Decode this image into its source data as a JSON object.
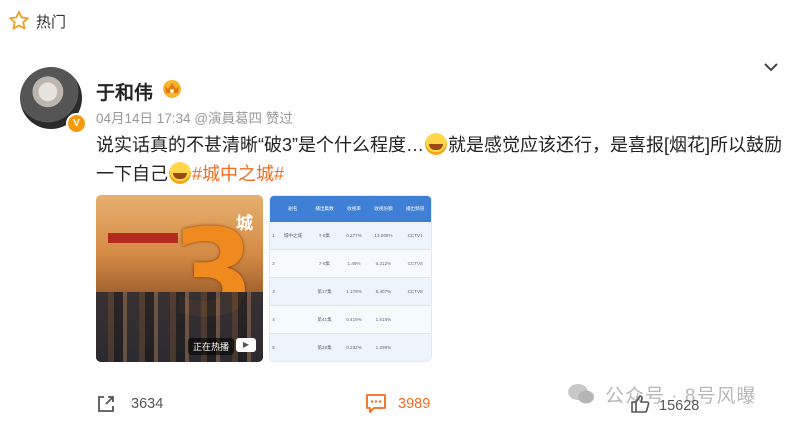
{
  "header": {
    "label": "热门"
  },
  "author": {
    "name": "于和伟",
    "meta": "04月14日 17:34 @演員葛四 赞过"
  },
  "post": {
    "text_part1": "说实话真的不甚清晰“破3”是个什么程度…",
    "text_part2": "就是感觉应该还行，是喜报[烟花]所以鼓励一下自己",
    "hashtag": "#城中之城#"
  },
  "poster": {
    "sticker": "正在热播",
    "city": "城"
  },
  "ratings_table": {
    "headers": [
      "",
      "剧名",
      "播出集数",
      "收视率",
      "收视份额",
      "播出频道"
    ],
    "rows": [
      [
        "1",
        "城中之城",
        "7-8集",
        "0.277%",
        "13.068%",
        "CCTV1"
      ],
      [
        "2",
        "",
        "7-8集",
        "1.48%",
        "6.312%",
        "CCTV8"
      ],
      [
        "3",
        "",
        "第17集",
        "1.178%",
        "5.407%",
        "CCTV8"
      ],
      [
        "4",
        "",
        "第41集",
        "0.419%",
        "1.618%",
        ""
      ],
      [
        "5",
        "",
        "第28集",
        "0.332%",
        "1.298%",
        ""
      ]
    ]
  },
  "actions": {
    "share_count": "3634",
    "comment_count": "3989",
    "like_count": "15628"
  },
  "watermark": "公众号 · 8号风曝",
  "colors": {
    "accent": "#f46b1f",
    "muted": "#999999",
    "table_header": "#3f7fd6"
  }
}
